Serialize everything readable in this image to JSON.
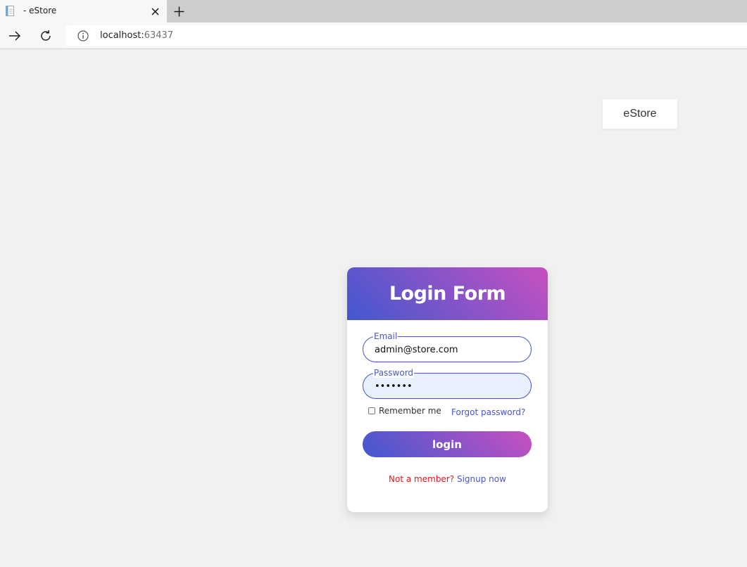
{
  "browser": {
    "tab_title": "- eStore",
    "url_host": "localhost:",
    "url_port": "63437"
  },
  "brand": {
    "label": "eStore"
  },
  "login_form": {
    "title": "Login Form",
    "email_label": "Email",
    "email_value": "admin@store.com",
    "password_label": "Password",
    "password_value": "1234567",
    "remember_label": "Remember me",
    "remember_checked": false,
    "forgot_label": "Forgot password?",
    "login_label": "login",
    "not_member_text": "Not a member?",
    "signup_label": "Signup now"
  },
  "colors": {
    "accent": "#4a55c8",
    "gradient_start": "#4158d0",
    "gradient_end": "#c850c0",
    "warning_text": "#e0161c"
  }
}
